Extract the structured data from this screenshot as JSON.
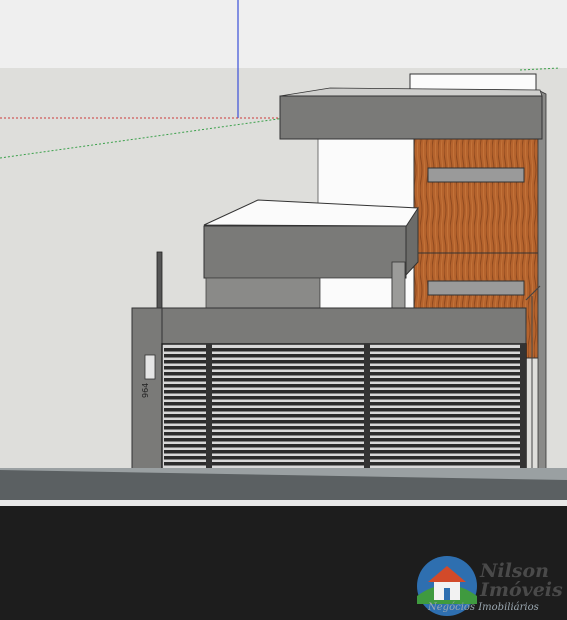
{
  "scene": {
    "colors": {
      "sky": "#eaeaea",
      "ground": "#dcdcd9",
      "concrete": "#7a7a78",
      "wall_white": "#fbfbfb",
      "wood": "#b4622c",
      "gate_bars": "#2b2b2b",
      "sidewalk": "#5a5f61",
      "road": "#1d1d1d",
      "axis_blue": "#3b4fd8",
      "axis_red": "#cc3a3a",
      "axis_green": "#3aa04a"
    },
    "house_number": "964"
  },
  "watermark": {
    "title_line1": "Nilson",
    "title_line2": "Imóveis",
    "subtitle": "Negócios Imobiliários"
  }
}
